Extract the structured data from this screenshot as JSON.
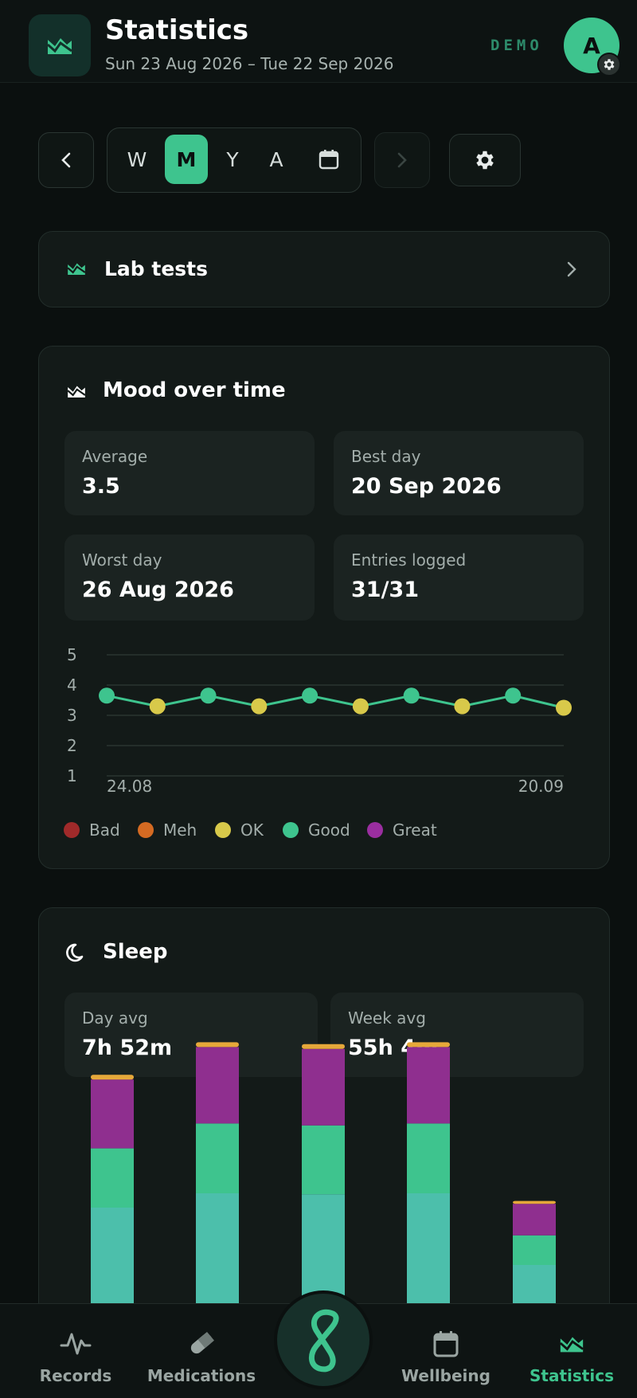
{
  "header": {
    "title": "Statistics",
    "date_range": "Sun 23 Aug 2026 – Tue 22 Sep 2026",
    "demo_label": "DEMO",
    "avatar_initial": "A"
  },
  "period": {
    "options": [
      "W",
      "M",
      "Y",
      "A"
    ],
    "selected": "M"
  },
  "lab_tests": {
    "label": "Lab tests"
  },
  "mood": {
    "title": "Mood over time",
    "stats": [
      {
        "label": "Average",
        "value": "3.5"
      },
      {
        "label": "Best day",
        "value": "20 Sep 2026"
      },
      {
        "label": "Worst day",
        "value": "26 Aug 2026"
      },
      {
        "label": "Entries logged",
        "value": "31/31"
      }
    ],
    "legend": [
      {
        "label": "Bad",
        "color": "#a02a2a"
      },
      {
        "label": "Meh",
        "color": "#d46a22"
      },
      {
        "label": "OK",
        "color": "#d8c94a"
      },
      {
        "label": "Good",
        "color": "#3ec48e"
      },
      {
        "label": "Great",
        "color": "#9a2ea0"
      }
    ]
  },
  "sleep": {
    "title": "Sleep",
    "stats": [
      {
        "label": "Day avg",
        "value": "7h 52m"
      },
      {
        "label": "Week avg",
        "value": "55h 4m"
      }
    ]
  },
  "chart_data": [
    {
      "type": "line",
      "x_tick_labels": [
        "24.08",
        "20.09"
      ],
      "y_ticks": [
        1,
        2,
        3,
        4,
        5
      ],
      "ylim": [
        1,
        5
      ],
      "grid": true,
      "series": [
        {
          "values": [
            3.65,
            3.3,
            3.65,
            3.3,
            3.65,
            3.3,
            3.65,
            3.3,
            3.65,
            3.25
          ],
          "point_colors": [
            "#3ec48e",
            "#d8c94a",
            "#3ec48e",
            "#d8c94a",
            "#3ec48e",
            "#d8c94a",
            "#3ec48e",
            "#d8c94a",
            "#3ec48e",
            "#d8c94a"
          ]
        }
      ]
    },
    {
      "type": "bar",
      "stacked": true,
      "segment_colors": [
        "#4cbfab",
        "#3ec48e",
        "#8f2f8f",
        "#e6a83a"
      ],
      "bars": [
        [
          1.0,
          0.62,
          0.72,
          0.05
        ],
        [
          1.15,
          0.73,
          0.8,
          0.05
        ],
        [
          1.14,
          0.72,
          0.8,
          0.05
        ],
        [
          1.15,
          0.73,
          0.8,
          0.05
        ],
        [
          0.4,
          0.31,
          0.33,
          0.03
        ]
      ]
    }
  ],
  "tabs": [
    {
      "label": "Records",
      "icon": "activity-icon"
    },
    {
      "label": "Medications",
      "icon": "pill-icon"
    },
    {
      "label": "Wellbeing",
      "icon": "calendar-icon"
    },
    {
      "label": "Statistics",
      "icon": "chart-icon"
    }
  ],
  "colors": {
    "accent": "#3ec48e",
    "background": "#0b100f",
    "card": "#131a18"
  }
}
